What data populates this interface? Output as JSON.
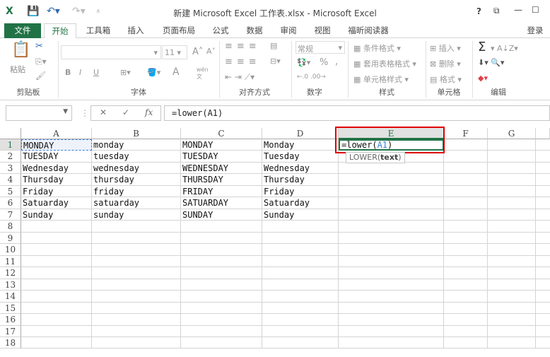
{
  "titlebar": {
    "title": "新建 Microsoft Excel 工作表.xlsx - Microsoft Excel",
    "help": "?",
    "restore": "⧉",
    "minimize": "—",
    "maximize": "☐"
  },
  "tabs": [
    {
      "label": "文件"
    },
    {
      "label": "开始"
    },
    {
      "label": "工具箱"
    },
    {
      "label": "插入"
    },
    {
      "label": "页面布局"
    },
    {
      "label": "公式"
    },
    {
      "label": "数据"
    },
    {
      "label": "审阅"
    },
    {
      "label": "视图"
    },
    {
      "label": "福昕阅读器"
    }
  ],
  "login": "登录",
  "ribbon": {
    "clipboard": {
      "label": "剪贴板",
      "paste": "粘贴"
    },
    "font": {
      "label": "字体",
      "size": "11",
      "bold": "B",
      "italic": "I",
      "underline": "U",
      "grow": "A˄",
      "shrink": "A˅",
      "font_color": "A",
      "phonetic": "wén文"
    },
    "alignment": {
      "label": "对齐方式"
    },
    "number": {
      "label": "数字",
      "format": "常规",
      "percent": "%",
      "comma": ","
    },
    "styles": {
      "label": "样式",
      "conditional": "条件格式",
      "table": "套用表格格式",
      "cell_styles": "单元格样式"
    },
    "cells": {
      "label": "单元格",
      "insert": "插入",
      "delete": "删除",
      "format": "格式"
    },
    "editing": {
      "label": "编辑",
      "sum": "Σ"
    }
  },
  "formula_bar": {
    "name_box": "",
    "cancel": "✕",
    "enter": "✓",
    "fx": "fx",
    "formula": "=lower(A1)"
  },
  "sheet": {
    "columns": [
      "A",
      "B",
      "C",
      "D",
      "E",
      "F",
      "G"
    ],
    "rows": [
      "1",
      "2",
      "3",
      "4",
      "5",
      "6",
      "7",
      "8",
      "9",
      "10",
      "11",
      "12",
      "13",
      "14",
      "15",
      "16",
      "17",
      "18"
    ],
    "cells": [
      [
        "MONDAY",
        "monday",
        "MONDAY",
        "Monday"
      ],
      [
        "TUESDAY",
        "tuesday",
        "TUESDAY",
        "Tuesday"
      ],
      [
        "Wednesday",
        "wednesday",
        "WEDNESDAY",
        "Wednesday"
      ],
      [
        "Thursday",
        "thursday",
        "THURSDAY",
        "Thursday"
      ],
      [
        "Friday",
        "friday",
        "FRIDAY",
        "Friday"
      ],
      [
        "Satuarday",
        "satuarday",
        "SATUARDAY",
        "Satuarday"
      ],
      [
        "Sunday",
        "sunday",
        "SUNDAY",
        "Sunday"
      ]
    ],
    "active_cell": {
      "prefix": "=lower(",
      "ref": "A1",
      "suffix": ")"
    },
    "tooltip": {
      "fn": "LOWER(",
      "arg": "text",
      "close": ")"
    }
  },
  "colors": {
    "accent": "#217346",
    "highlight": "#e00000",
    "ref": "#3b7fd9"
  }
}
